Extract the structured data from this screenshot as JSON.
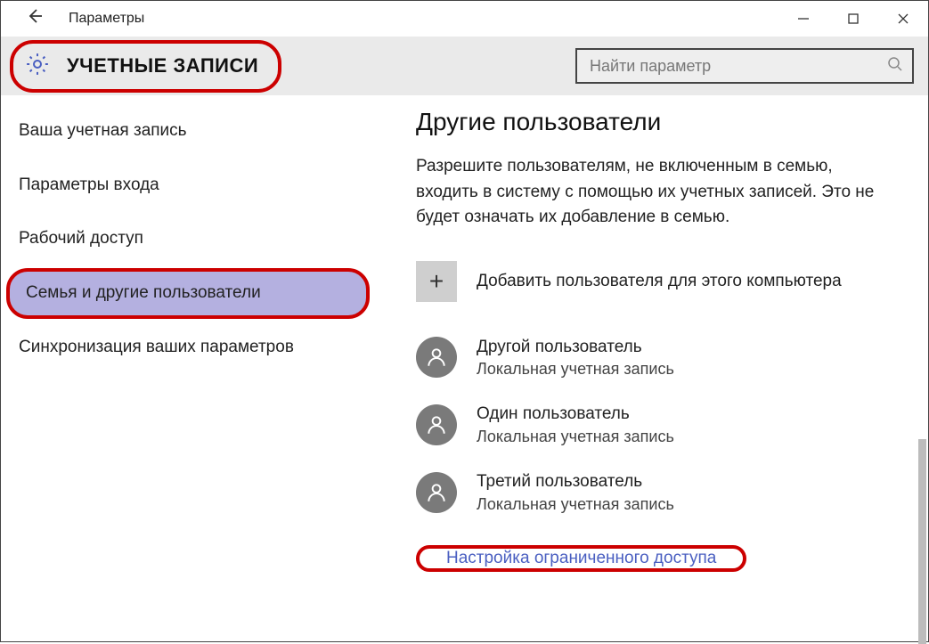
{
  "titlebar": {
    "title": "Параметры"
  },
  "header": {
    "heading": "УЧЕТНЫЕ ЗАПИСИ",
    "search_placeholder": "Найти параметр"
  },
  "sidebar": {
    "items": [
      {
        "label": "Ваша учетная запись"
      },
      {
        "label": "Параметры входа"
      },
      {
        "label": "Рабочий доступ"
      },
      {
        "label": "Семья и другие пользователи"
      },
      {
        "label": "Синхронизация ваших параметров"
      }
    ]
  },
  "content": {
    "section_title": "Другие пользователи",
    "section_desc": "Разрешите пользователям, не включенным в семью, входить в систему с помощью их учетных записей. Это не будет означать их добавление в семью.",
    "add_user_label": "Добавить пользователя для этого компьютера",
    "users": [
      {
        "name": "Другой пользователь",
        "sub": "Локальная учетная запись"
      },
      {
        "name": "Один пользователь",
        "sub": "Локальная учетная запись"
      },
      {
        "name": "Третий пользователь",
        "sub": "Локальная учетная запись"
      }
    ],
    "config_link": "Настройка ограниченного доступа"
  }
}
